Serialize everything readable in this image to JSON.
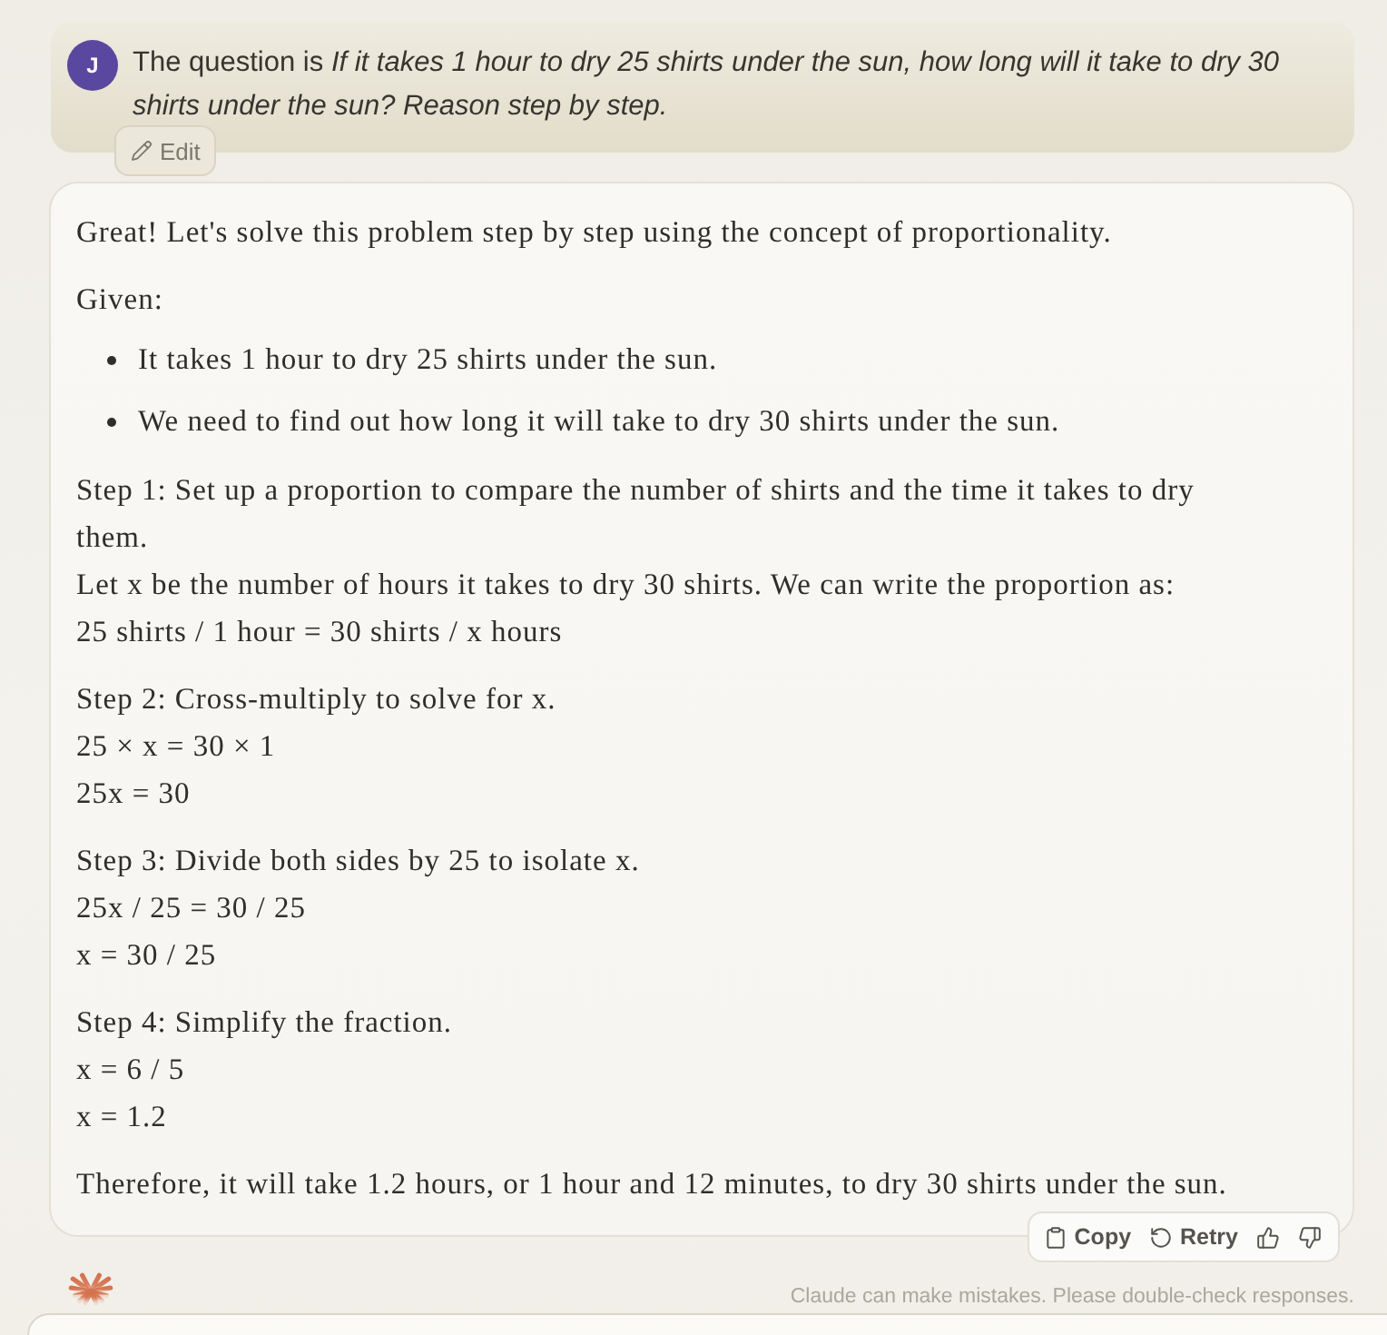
{
  "user_message": {
    "avatar_initial": "J",
    "text": "The question is *If it takes 1 hour to dry 25 shirts under the sun, how long will it take to dry 30 shirts under the sun? Reason step by step.*",
    "edit_label": "Edit"
  },
  "response": {
    "blocks": [
      {
        "kind": "paragraph",
        "lines": [
          "Great! Let's solve this problem step by step using the concept of proportionality."
        ]
      },
      {
        "kind": "paragraph",
        "lines": [
          "Given:"
        ]
      },
      {
        "kind": "bullets",
        "items": [
          "It takes 1 hour to dry 25 shirts under the sun.",
          "We need to find out how long it will take to dry 30 shirts under the sun."
        ]
      },
      {
        "kind": "paragraph",
        "lines": [
          "Step 1: Set up a proportion to compare the number of shirts and the time it takes to dry them.",
          "Let x be the number of hours it takes to dry 30 shirts. We can write the proportion as:",
          "25 shirts / 1 hour = 30 shirts / x hours"
        ]
      },
      {
        "kind": "paragraph",
        "lines": [
          "Step 2: Cross-multiply to solve for x.",
          "25 × x = 30 × 1",
          "25x = 30"
        ]
      },
      {
        "kind": "paragraph",
        "lines": [
          "Step 3: Divide both sides by 25 to isolate x.",
          "25x / 25 = 30 / 25",
          "x = 30 / 25"
        ]
      },
      {
        "kind": "paragraph",
        "lines": [
          "Step 4: Simplify the fraction.",
          "x = 6 / 5",
          "x = 1.2"
        ]
      },
      {
        "kind": "paragraph",
        "lines": [
          "Therefore, it will take 1.2 hours, or 1 hour and 12 minutes, to dry 30 shirts under the sun."
        ]
      }
    ]
  },
  "actions": [
    {
      "kind": "copy",
      "label": "Copy"
    },
    {
      "kind": "retry",
      "label": "Retry"
    },
    {
      "kind": "thumbs_up"
    },
    {
      "kind": "thumbs_down"
    }
  ],
  "disclaimer": "Claude can make mistakes. Please double-check responses."
}
